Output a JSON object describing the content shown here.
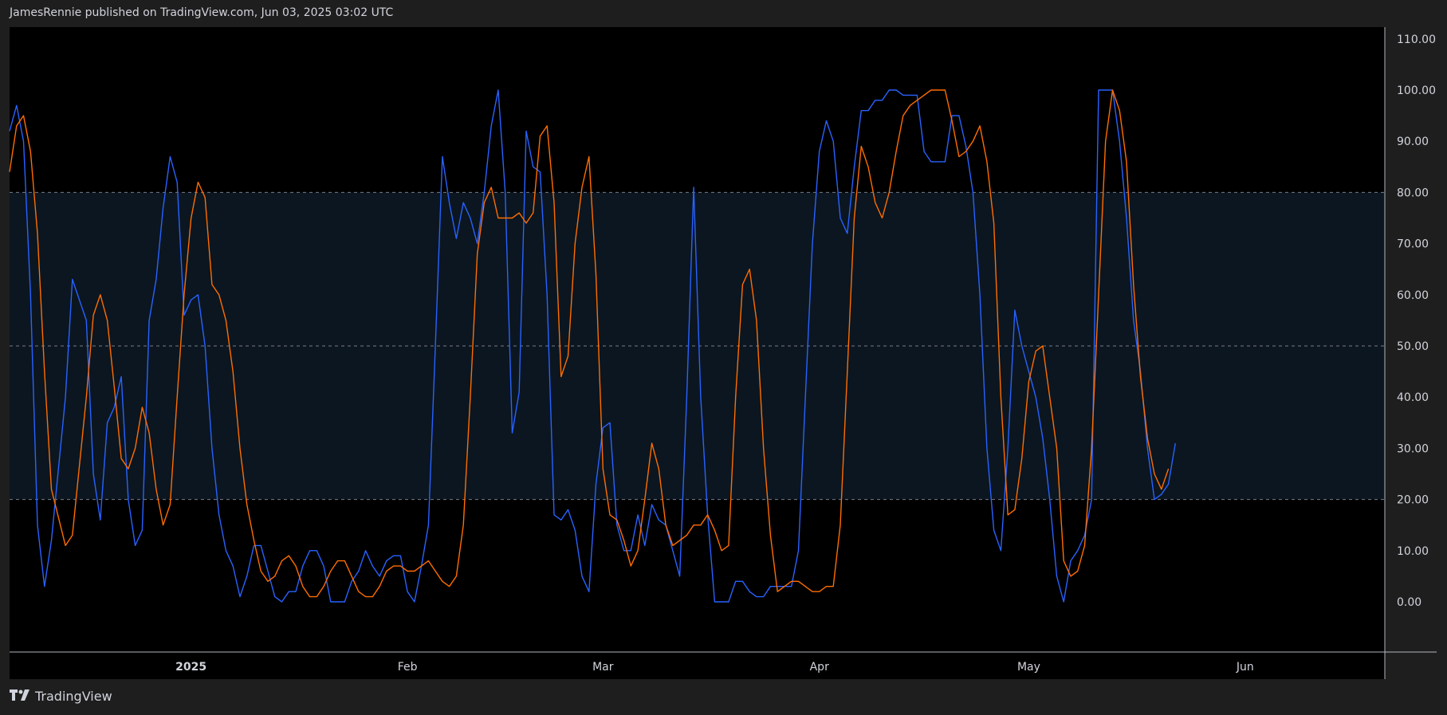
{
  "header": {
    "text": "JamesRennie published on TradingView.com, Jun 03, 2025 03:02 UTC"
  },
  "footer": {
    "brand": "TradingView",
    "logo_icon": "tradingview-logo-icon"
  },
  "colors": {
    "background": "#000000",
    "band": "#0b1620",
    "k_line": "#2962ff",
    "d_line": "#ff6d00",
    "grid_dash": "#787b86"
  },
  "chart_data": {
    "type": "line",
    "title": "",
    "ylim": [
      -10,
      110
    ],
    "yticks": [
      "110.00",
      "100.00",
      "90.00",
      "80.00",
      "70.00",
      "60.00",
      "50.00",
      "40.00",
      "30.00",
      "20.00",
      "10.00",
      "0.00"
    ],
    "ytick_values": [
      110,
      100,
      90,
      80,
      70,
      60,
      50,
      40,
      30,
      20,
      10,
      0
    ],
    "xticks": [
      {
        "label": "2025",
        "day": 0,
        "bold": true
      },
      {
        "label": "Feb",
        "day": 31,
        "bold": false
      },
      {
        "label": "Mar",
        "day": 59,
        "bold": false
      },
      {
        "label": "Apr",
        "day": 90,
        "bold": false
      },
      {
        "label": "May",
        "day": 120,
        "bold": false
      },
      {
        "label": "Jun",
        "day": 151,
        "bold": false
      }
    ],
    "xlim_days": [
      -26,
      171
    ],
    "band": [
      20,
      80
    ],
    "hlines": [
      20,
      50,
      80
    ],
    "series": [
      {
        "values_day": [
          -26,
          -25,
          -24,
          -23,
          -22,
          -21,
          -20,
          -18,
          -17,
          -15,
          -14,
          -13,
          -12,
          -11,
          -10,
          -9,
          -8,
          -7,
          -6,
          -5,
          -4,
          -3,
          -2,
          -1,
          0,
          1,
          2,
          3,
          4,
          5,
          6,
          7,
          8,
          9,
          10,
          11,
          12,
          13,
          14,
          15,
          16,
          17,
          18,
          19,
          20,
          21,
          22,
          23,
          24,
          25,
          26,
          27,
          28,
          29,
          30,
          31,
          32,
          33,
          34,
          35,
          36,
          37,
          38,
          39,
          40,
          41,
          42,
          43,
          44,
          45,
          46,
          47,
          48,
          49,
          50,
          51,
          52,
          53,
          54,
          55,
          56,
          57,
          58,
          59,
          60,
          61,
          62,
          63,
          64,
          65,
          66,
          67,
          68,
          69,
          70,
          71,
          72,
          73,
          74,
          75,
          76,
          77,
          78,
          79,
          80,
          81,
          82,
          83,
          84,
          85,
          86,
          87,
          88,
          89,
          90,
          91,
          92,
          93,
          94,
          95,
          96,
          97,
          98,
          99,
          100,
          101,
          102,
          103,
          104,
          105,
          106,
          107,
          108,
          109,
          110,
          111,
          112,
          113,
          114,
          115,
          116,
          117,
          118,
          119,
          120,
          121,
          122,
          123,
          124,
          125,
          126,
          127,
          128,
          129,
          130,
          131,
          132,
          133,
          134,
          135,
          136,
          137,
          138,
          139,
          140,
          141,
          142,
          143,
          144,
          145,
          146,
          147,
          148,
          149,
          150,
          151,
          152,
          153
        ],
        "values": [
          92,
          97,
          90,
          60,
          15,
          3,
          12,
          40,
          63,
          55,
          25,
          16,
          35,
          38,
          44,
          20,
          11,
          14,
          55,
          63,
          77,
          87,
          82,
          56,
          59,
          60,
          50,
          30,
          17,
          10,
          7,
          1,
          5,
          11,
          11,
          6,
          1,
          0,
          2,
          2,
          7,
          10,
          10,
          7,
          0,
          0,
          0,
          4,
          6,
          10,
          7,
          5,
          8,
          9,
          9,
          2,
          0,
          7,
          15,
          50,
          87,
          78,
          71,
          78,
          75,
          70,
          80,
          93,
          100,
          80,
          33,
          41,
          92,
          85,
          84,
          60,
          17,
          16,
          18,
          14,
          5,
          2,
          23,
          34,
          35,
          15,
          10,
          10,
          17,
          11,
          19,
          16,
          15,
          10,
          5,
          40,
          81,
          40,
          17,
          0,
          0,
          0,
          4,
          4,
          2,
          1,
          1,
          3,
          3,
          3,
          3,
          10,
          40,
          70,
          88,
          94,
          90,
          75,
          72,
          85,
          96,
          96,
          98,
          98,
          100,
          100,
          99,
          99,
          99,
          88,
          86,
          86,
          86,
          95,
          95,
          89,
          80,
          60,
          30,
          14,
          10,
          30,
          57,
          50,
          45,
          40,
          32,
          20,
          5,
          0,
          8,
          10,
          13,
          20,
          100,
          100,
          100,
          90,
          75,
          55,
          45,
          30,
          20,
          21,
          23,
          31
        ],
        "name": ""
      },
      {
        "values": [
          84,
          93,
          95,
          88,
          72,
          45,
          22,
          11,
          13,
          40,
          56,
          60,
          55,
          42,
          28,
          26,
          30,
          38,
          33,
          22,
          15,
          19,
          40,
          60,
          75,
          82,
          79,
          62,
          60,
          55,
          45,
          30,
          19,
          12,
          6,
          4,
          5,
          8,
          9,
          7,
          3,
          1,
          1,
          3,
          6,
          8,
          8,
          5,
          2,
          1,
          1,
          3,
          6,
          7,
          7,
          6,
          6,
          7,
          8,
          6,
          4,
          3,
          5,
          15,
          40,
          68,
          78,
          81,
          75,
          75,
          75,
          76,
          74,
          76,
          91,
          93,
          78,
          44,
          48,
          70,
          81,
          87,
          64,
          26,
          17,
          16,
          12,
          7,
          10,
          20,
          31,
          26,
          15,
          11,
          12,
          13,
          15,
          15,
          17,
          14,
          10,
          11,
          40,
          62,
          65,
          55,
          30,
          13,
          2,
          3,
          4,
          4,
          3,
          2,
          2,
          3,
          3,
          15,
          45,
          75,
          89,
          85,
          78,
          75,
          80,
          88,
          95,
          97,
          98,
          99,
          100,
          100,
          100,
          94,
          87,
          88,
          90,
          93,
          86,
          74,
          40,
          17,
          18,
          28,
          43,
          49,
          50,
          40,
          30,
          8,
          5,
          6,
          11,
          30,
          60,
          90,
          100,
          96,
          86,
          62,
          44,
          32,
          25,
          22,
          26
        ],
        "name": ""
      }
    ]
  }
}
